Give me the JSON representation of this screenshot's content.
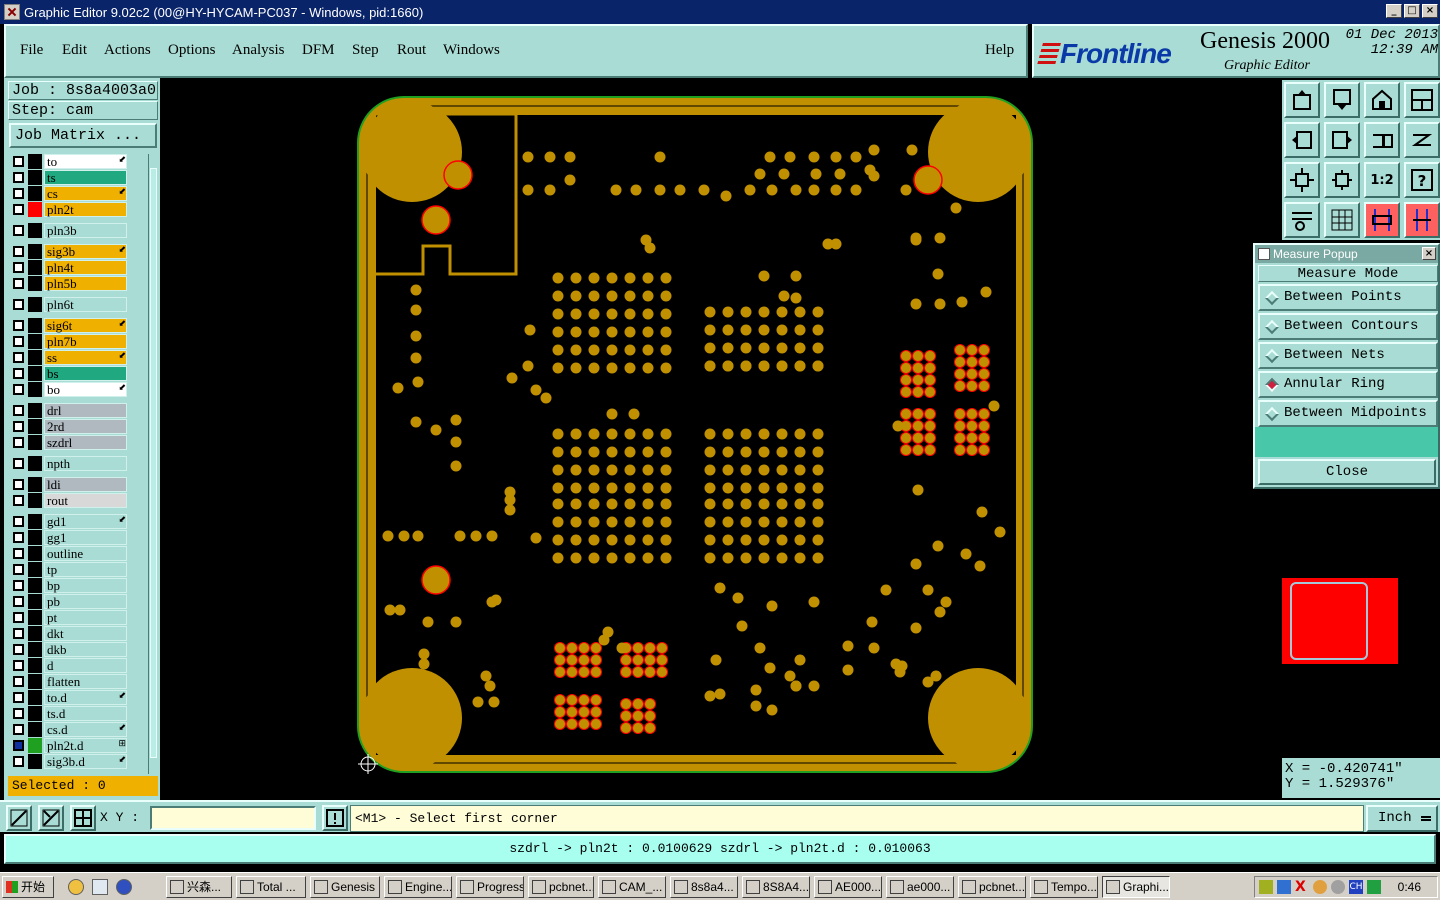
{
  "window": {
    "title": "Graphic Editor 9.02c2 (00@HY-HYCAM-PC037 - Windows, pid:1660)"
  },
  "menu": [
    "File",
    "Edit",
    "Actions",
    "Options",
    "Analysis",
    "DFM",
    "Step",
    "Rout",
    "Windows"
  ],
  "help": "Help",
  "brand": {
    "logo": "Frontline",
    "title": "Genesis 2000",
    "subtitle": "Graphic Editor",
    "date": "01 Dec 2013",
    "time": "12:39 AM"
  },
  "job": {
    "job_line": "Job : 8s8a4003a0",
    "step_line": "Step: cam",
    "matrix_button": "Job Matrix ..."
  },
  "layers": [
    {
      "name": "to",
      "color": "#ffffff",
      "swatch": "#000000",
      "mark": "⬋"
    },
    {
      "name": "ts",
      "color": "#20a880",
      "swatch": "#000000",
      "mark": ""
    },
    {
      "name": "cs",
      "color": "#f0b000",
      "swatch": "#000000",
      "mark": "⬋"
    },
    {
      "name": "pln2t",
      "color": "#f0b000",
      "swatch": "#ff0000",
      "mark": ""
    },
    {
      "name": "pln3b",
      "color": "#a8dcd4",
      "swatch": "#000000",
      "mark": ""
    },
    {
      "name": "sig3b",
      "color": "#f0b000",
      "swatch": "#000000",
      "mark": "⬋"
    },
    {
      "name": "pln4t",
      "color": "#f0b000",
      "swatch": "#000000",
      "mark": ""
    },
    {
      "name": "pln5b",
      "color": "#f0b000",
      "swatch": "#000000",
      "mark": ""
    },
    {
      "name": "pln6t",
      "color": "#a8dcd4",
      "swatch": "#000000",
      "mark": ""
    },
    {
      "name": "sig6t",
      "color": "#f0b000",
      "swatch": "#000000",
      "mark": "⬋"
    },
    {
      "name": "pln7b",
      "color": "#f0b000",
      "swatch": "#000000",
      "mark": ""
    },
    {
      "name": "ss",
      "color": "#f0b000",
      "swatch": "#000000",
      "mark": "⬋"
    },
    {
      "name": "bs",
      "color": "#20a880",
      "swatch": "#000000",
      "mark": ""
    },
    {
      "name": "bo",
      "color": "#ffffff",
      "swatch": "#000000",
      "mark": "⬋"
    },
    {
      "name": "drl",
      "color": "#b0b8c0",
      "swatch": "#000000",
      "mark": ""
    },
    {
      "name": "2rd",
      "color": "#b0b8c0",
      "swatch": "#000000",
      "mark": ""
    },
    {
      "name": "szdrl",
      "color": "#b0b8c0",
      "swatch": "#000000",
      "mark": ""
    },
    {
      "name": "npth",
      "color": "#a8dcd4",
      "swatch": "#000000",
      "mark": ""
    },
    {
      "name": "ldi",
      "color": "#b0b8c0",
      "swatch": "#000000",
      "mark": ""
    },
    {
      "name": "rout",
      "color": "#d8d8d8",
      "swatch": "#000000",
      "mark": ""
    },
    {
      "name": "gd1",
      "color": "#a8dcd4",
      "swatch": "#000000",
      "mark": "⬋"
    },
    {
      "name": "gg1",
      "color": "#a8dcd4",
      "swatch": "#000000",
      "mark": ""
    },
    {
      "name": "outline",
      "color": "#a8dcd4",
      "swatch": "#000000",
      "mark": ""
    },
    {
      "name": "tp",
      "color": "#a8dcd4",
      "swatch": "#000000",
      "mark": ""
    },
    {
      "name": "bp",
      "color": "#a8dcd4",
      "swatch": "#000000",
      "mark": ""
    },
    {
      "name": "pb",
      "color": "#a8dcd4",
      "swatch": "#000000",
      "mark": ""
    },
    {
      "name": "pt",
      "color": "#a8dcd4",
      "swatch": "#000000",
      "mark": ""
    },
    {
      "name": "dkt",
      "color": "#a8dcd4",
      "swatch": "#000000",
      "mark": ""
    },
    {
      "name": "dkb",
      "color": "#a8dcd4",
      "swatch": "#000000",
      "mark": ""
    },
    {
      "name": "d",
      "color": "#a8dcd4",
      "swatch": "#000000",
      "mark": ""
    },
    {
      "name": "flatten",
      "color": "#a8dcd4",
      "swatch": "#000000",
      "mark": ""
    },
    {
      "name": "to.d",
      "color": "#a8dcd4",
      "swatch": "#000000",
      "mark": "⬋"
    },
    {
      "name": "ts.d",
      "color": "#a8dcd4",
      "swatch": "#000000",
      "mark": ""
    },
    {
      "name": "cs.d",
      "color": "#a8dcd4",
      "swatch": "#000000",
      "mark": "⬋"
    },
    {
      "name": "pln2t.d",
      "color": "#a8dcd4",
      "swatch": "#20a020",
      "mark": "⊞"
    },
    {
      "name": "sig3b.d",
      "color": "#a8dcd4",
      "swatch": "#000000",
      "mark": "⬋"
    }
  ],
  "selected": "Selected : 0",
  "measure": {
    "title": "Measure Popup",
    "mode_label": "Measure Mode",
    "options": [
      "Between Points",
      "Between Contours",
      "Between Nets",
      "Annular Ring",
      "Between Midpoints"
    ],
    "selected_index": 3,
    "close": "Close"
  },
  "coords": {
    "x": "X = -0.420741\"",
    "y": "Y = 1.529376\""
  },
  "command": {
    "xy_label": "X Y :",
    "xy_value": "",
    "prompt": "<M1> - Select first corner",
    "unit": "Inch"
  },
  "status": "szdrl -> pln2t : 0.0100629   szdrl -> pln2t.d : 0.010063",
  "taskbar": {
    "start": "开始",
    "tasks": [
      "兴森...",
      "Total ...",
      "Genesis",
      "Engine...",
      "Progress",
      "pcbnet...",
      "CAM_...",
      "8s8a4...",
      "8S8A4...",
      "AE000...",
      "ae000...",
      "pcbnet...",
      "Tempo...",
      "Graphi..."
    ],
    "active_index": 13,
    "clock": "0:46"
  },
  "colors": {
    "copper": "#c09000",
    "panel": "#a8dcd4",
    "highlight": "#ff0000"
  }
}
